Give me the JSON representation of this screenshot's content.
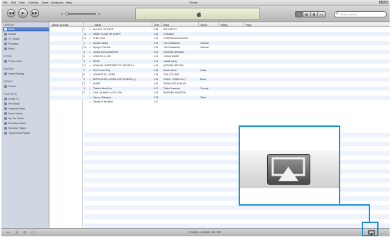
{
  "window": {
    "title": "iTunes"
  },
  "menubar": [
    "File",
    "Edit",
    "View",
    "Controls",
    "Store",
    "Advanced",
    "Help"
  ],
  "toolbar": {
    "prev_icon": "rewind-icon",
    "play_icon": "play-icon",
    "next_icon": "fast-forward-icon",
    "volume_min_icon": "speaker-low-icon",
    "volume_max_icon": "speaker-high-icon",
    "lcd_icon": "apple-logo-icon",
    "search_placeholder": "Search Music"
  },
  "sidebar": {
    "sections": [
      {
        "title": "LIBRARY",
        "items": [
          "Music",
          "Movies",
          "TV Shows",
          "Podcasts",
          "Radio"
        ]
      },
      {
        "title": "STORE",
        "items": [
          "iTunes Store"
        ]
      },
      {
        "title": "SHARED",
        "items": [
          "Home Sharing"
        ]
      },
      {
        "title": "GENIUS",
        "items": [
          "Genius"
        ]
      },
      {
        "title": "PLAYLISTS",
        "items": [
          "iTunes DJ",
          "90's Music",
          "Classical Music",
          "Music Videos",
          "My Top Rated",
          "Recently Added",
          "Recently Played",
          "Top 25 Most Played"
        ]
      }
    ],
    "selected": "Music"
  },
  "list": {
    "columns": [
      "Album by Artist",
      "Name",
      "Time",
      "Artist",
      "Genre",
      "Rating",
      "Plays"
    ],
    "rows": [
      {
        "n": "1",
        "name": "ALL OUT OF LOVE",
        "time": "3:54",
        "artist": "AIR SUPPLY",
        "genre": ""
      },
      {
        "n": "10",
        "name": "HARD TO SAY I'M SORRY",
        "time": "3:52",
        "artist": "CHICAGO",
        "genre": ""
      },
      {
        "n": "14",
        "name": "I'll Be There",
        "time": "4:37",
        "artist": "CHRISTINA AGUILERA",
        "genre": ""
      },
      {
        "n": "1",
        "name": "Animal Instinct",
        "time": "3:31",
        "artist": "The Cranberries",
        "genre": "General"
      },
      {
        "n": "13",
        "name": "Dying In The Sun",
        "time": "3:31",
        "artist": "The Cranberries",
        "genre": "General"
      },
      {
        "n": "8",
        "name": "CARELESS WHISPERS",
        "time": "5:01",
        "artist": "GEORGE MICHAEL",
        "genre": ""
      },
      {
        "n": "9",
        "name": "HOW DO U LIVE",
        "time": "4:26",
        "artist": "LEANN RIMES",
        "genre": ""
      },
      {
        "n": "5",
        "name": "HERO",
        "time": "4:19",
        "artist": "mariah carey",
        "genre": ""
      },
      {
        "n": "11",
        "name": "HOW AM I SUPPOSED TO LIVE WITH...",
        "time": "4:15",
        "artist": "MICHAEL BOLTON",
        "genre": ""
      },
      {
        "n": "2",
        "name": "Don't Know Why",
        "time": "3:06",
        "artist": "Norah Jones",
        "genre": "Vocal"
      },
      {
        "n": "9",
        "name": "AGAINST ALL ODDS",
        "time": "3:26",
        "artist": "PHIL COLLINS",
        "genre": ""
      },
      {
        "n": "2",
        "name": "BEETHOVEN: MOONLIGHT SONATA (1)",
        "time": "6:01",
        "artist": "PIANO - ROBIN ALC...",
        "genre": "Blues"
      },
      {
        "n": "3",
        "name": "ANGEL",
        "time": "4:30",
        "artist": "SARAH MCLACHLAN",
        "genre": ""
      },
      {
        "n": "3",
        "name": "Thinkin' About You",
        "time": "3:27",
        "artist": "Trisha Yearwood",
        "genre": "Country"
      },
      {
        "n": "2",
        "name": "I WILL ALWAYS LOVE YOU",
        "time": "4:31",
        "artist": "WHITNEY HOUSTON",
        "genre": ""
      },
      {
        "n": "",
        "name": "Canon_Plaisance",
        "time": "3:38",
        "artist": "",
        "genre": "Other"
      },
      {
        "n": "",
        "name": "Candle in the Wind",
        "time": "4:10",
        "artist": "",
        "genre": ""
      }
    ]
  },
  "status": {
    "text": "17 songs, 1.2 hours, 105.7 MB"
  },
  "statusbar_icons": [
    "add-playlist-icon",
    "shuffle-icon",
    "repeat-icon",
    "show-artwork-icon"
  ],
  "callout": {
    "icon": "airplay-icon",
    "accent_color": "#1b8fd2"
  }
}
